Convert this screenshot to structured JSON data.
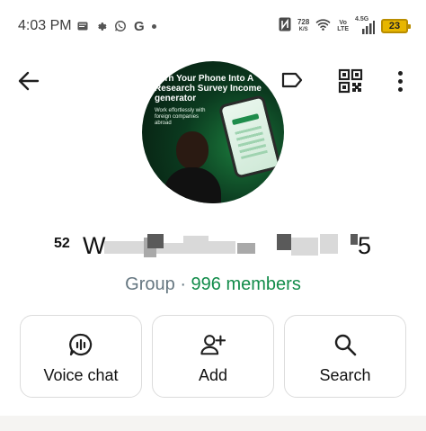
{
  "status_bar": {
    "time": "4:03 PM",
    "left_icons": [
      "message-icon",
      "gear-icon",
      "whatsapp-icon",
      "google-icon",
      "dot-icon"
    ],
    "google_letter": "G",
    "net_speed_value": "728",
    "net_speed_unit": "K/S",
    "vo_label": "Vo",
    "lte_label": "LTE",
    "network_label": "4.5G",
    "battery_level": "23",
    "colors": {
      "battery": "#e7b600"
    }
  },
  "header": {
    "back_icon": "arrow-left-icon",
    "label_icon": "label-tag-icon",
    "qr_icon": "qr-code-icon",
    "menu_icon": "more-vertical-icon"
  },
  "avatar": {
    "headline": "Turn Your Phone Into A Research Survey Income generator",
    "subtext": "Work effortlessly with foreign companies abroad"
  },
  "group": {
    "name_prefix": "52",
    "name_visible": "W",
    "name_suffix": "5",
    "type_label": "Group",
    "separator": "·",
    "members_label": "996 members",
    "colors": {
      "members": "#128c4a",
      "subtitle": "#667781"
    }
  },
  "actions": [
    {
      "label": "Voice chat",
      "icon": "voice-chat-icon"
    },
    {
      "label": "Add",
      "icon": "add-person-icon"
    },
    {
      "label": "Search",
      "icon": "search-icon"
    }
  ]
}
